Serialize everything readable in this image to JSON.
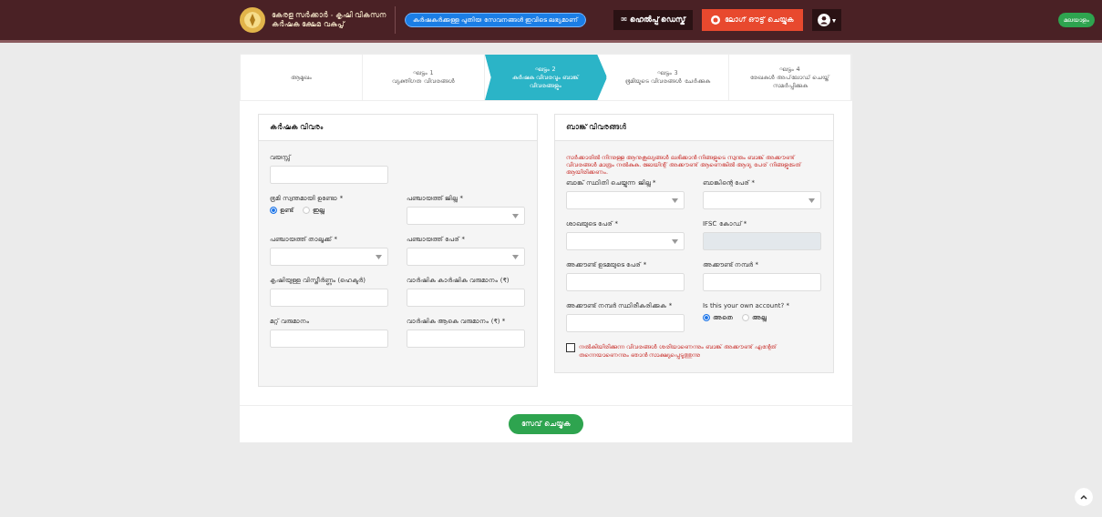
{
  "header": {
    "title_lines": [
      "കേരള സർക്കാർ - കൃഷി വികസന",
      "കർഷക ക്ഷേമ വകുപ്പ്"
    ],
    "notice_button": "കർഷകർക്കുള്ള പുതിയ സേവനങ്ങൾ ഇവിടെ ലഭ്യമാണ്",
    "help_button": "✉ ഹെൽപ്പ് ഡെസ്ക്",
    "logout_button": "ലോഗ് ഔട്ട് ചെയ്യുക",
    "user_caret": "▾",
    "badge": "മലയാളം"
  },
  "steps": [
    {
      "title": "ആമുഖം",
      "selected": false
    },
    {
      "number": "ഘട്ടം 1",
      "title": "വ്യക്തിഗത വിവരങ്ങൾ",
      "selected": false
    },
    {
      "number": "ഘട്ടം 2",
      "title": "കർഷക വിവരവും ബാങ്ക് വിവരങ്ങളും",
      "selected": true
    },
    {
      "number": "ഘട്ടം 3",
      "title": "ഭൂമിയുടെ വിവരങ്ങൾ ചേർക്കുക",
      "selected": false
    },
    {
      "number": "ഘട്ടം 4",
      "title": "രേഖകൾ അപ്‌ലോഡ് ചെയ്ത് സമർപ്പിക്കുക",
      "selected": false
    }
  ],
  "farmer_panel": {
    "title": "കർഷക വിവരം",
    "rows": [
      [
        {
          "kind": "input",
          "label": "വയസ്സ്",
          "disabled": false
        }
      ],
      [
        {
          "kind": "radio",
          "label": "ഭൂമി സ്വന്തമായി ഉണ്ടോ *",
          "options": [
            {
              "label": "ഉണ്ട്",
              "selected": true
            },
            {
              "label": "ഇല്ല",
              "selected": false
            }
          ]
        },
        {
          "kind": "select",
          "label": "പഞ്ചായത്ത് ജില്ല *",
          "disabled": false
        }
      ],
      [
        {
          "kind": "select",
          "label": "പഞ്ചായത്ത് താലൂക്ക് *",
          "disabled": false
        },
        {
          "kind": "select",
          "label": "പഞ്ചായത്ത് പേര് *",
          "disabled": false
        }
      ],
      [
        {
          "kind": "input",
          "label": "കൃഷിയുള്ള വിസ്തീർണ്ണം (ഹെക്ടർ)",
          "disabled": false
        },
        {
          "kind": "input",
          "label": "വാർഷിക കാർഷിക വരുമാനം (₹)",
          "disabled": false
        }
      ],
      [
        {
          "kind": "input",
          "label": "മറ്റ് വരുമാനം",
          "disabled": false
        },
        {
          "kind": "input",
          "label": "വാർഷിക ആകെ വരുമാനം (₹) *",
          "disabled": false
        }
      ]
    ]
  },
  "bank_panel": {
    "title": "ബാങ്ക് വിവരങ്ങൾ",
    "note": "സർക്കാരിൽ നിന്നുള്ള ആനുകൂല്യങ്ങൾ ലഭിക്കാൻ നിങ്ങളുടെ സ്വന്തം ബാങ്ക് അക്കൗണ്ട് വിവരങ്ങൾ മാത്രം നൽകുക. ജോയിന്റ് അക്കൗണ്ട് ആണെങ്കിൽ ആദ്യ പേര് നിങ്ങളുടേത് ആയിരിക്കണം.",
    "rows": [
      [
        {
          "kind": "select",
          "label": "ബാങ്ക് സ്ഥിതി ചെയ്യുന്ന ജില്ല *",
          "disabled": false
        },
        {
          "kind": "select",
          "label": "ബാങ്കിന്റെ പേര് *",
          "disabled": false
        }
      ],
      [
        {
          "kind": "select",
          "label": "ശാഖയുടെ പേര് *",
          "disabled": false
        },
        {
          "kind": "input",
          "label": "IFSC കോഡ് *",
          "disabled": true
        }
      ],
      [
        {
          "kind": "input",
          "label": "അക്കൗണ്ട് ഉടമയുടെ പേര് *",
          "disabled": false
        },
        {
          "kind": "input",
          "label": "അക്കൗണ്ട് നമ്പർ *",
          "disabled": false
        }
      ],
      [
        {
          "kind": "input",
          "label": "അക്കൗണ്ട് നമ്പർ സ്ഥിരീകരിക്കുക *",
          "disabled": false
        },
        {
          "kind": "radio",
          "label": "Is this your own account? *",
          "options": [
            {
              "label": "അതെ",
              "selected": true
            },
            {
              "label": "അല്ല",
              "selected": false
            }
          ]
        }
      ]
    ],
    "confirm": {
      "label": "നൽകിയിരിക്കുന്ന വിവരങ്ങൾ ശരിയാണെന്നും ബാങ്ക് അക്കൗണ്ട് എന്റേത് തന്നെയാണെന്നും ഞാൻ സാക്ഷ്യപ്പെടുത്തുന്നു",
      "checked": false
    }
  },
  "submit_button": "സേവ് ചെയ്യുക"
}
